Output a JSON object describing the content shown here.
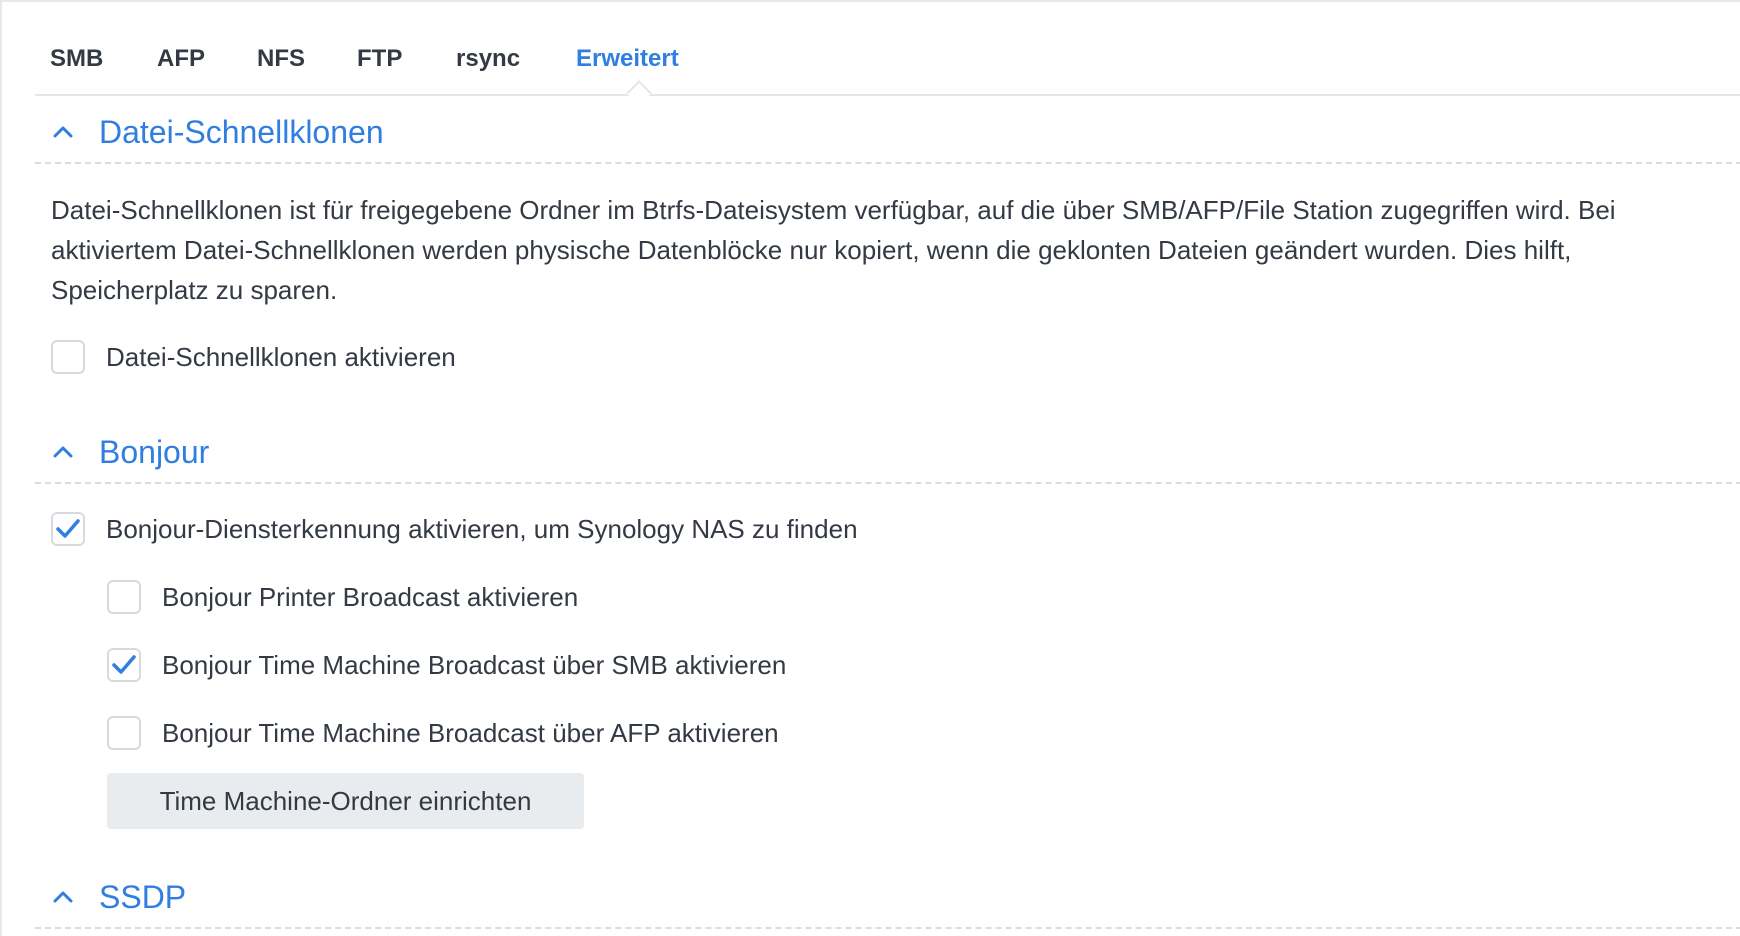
{
  "tabs": {
    "smb": "SMB",
    "afp": "AFP",
    "nfs": "NFS",
    "ftp": "FTP",
    "rsync": "rsync",
    "advanced": "Erweitert",
    "active": "Erweitert"
  },
  "clone": {
    "title": "Datei-Schnellklonen",
    "description": "Datei-Schnellklonen ist für freigegebene Ordner im Btrfs-Dateisystem verfügbar, auf die über SMB/AFP/File Station zugegriffen wird. Bei aktiviertem Datei-Schnellklonen werden physische Datenblöcke nur kopiert, wenn die geklonten Dateien geändert wurden. Dies hilft, Speicherplatz zu sparen.",
    "enable_label": "Datei-Schnellklonen aktivieren",
    "enable_checked": false
  },
  "bonjour": {
    "title": "Bonjour",
    "discovery_label": "Bonjour-Diensterkennung aktivieren, um Synology NAS zu finden",
    "discovery_checked": true,
    "printer_label": "Bonjour Printer Broadcast aktivieren",
    "printer_checked": false,
    "tm_smb_label": "Bonjour Time Machine Broadcast über SMB aktivieren",
    "tm_smb_checked": true,
    "tm_afp_label": "Bonjour Time Machine Broadcast über AFP aktivieren",
    "tm_afp_checked": false,
    "setup_button": "Time Machine-Ordner einrichten"
  },
  "ssdp": {
    "title": "SSDP"
  },
  "colors": {
    "accent": "#2f7ee0",
    "text": "#333a44",
    "button_bg": "#e9ecef"
  }
}
